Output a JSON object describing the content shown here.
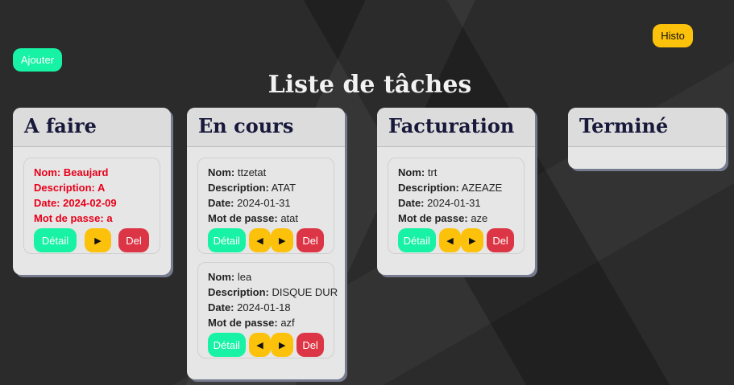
{
  "toolbar": {
    "add_label": "Ajouter",
    "history_label": "Histo"
  },
  "page_title": "Liste de tâches",
  "field_labels": {
    "name": "Nom:",
    "description": "Description:",
    "date": "Date:",
    "password": "Mot de passe:"
  },
  "button_labels": {
    "detail": "Détail",
    "prev": "◀",
    "next": "▶",
    "delete": "Del"
  },
  "columns": [
    {
      "title": "A faire",
      "tasks": [
        {
          "name": "Beaujard",
          "description": "A",
          "date": "2024-02-09",
          "password": "a"
        }
      ]
    },
    {
      "title": "En cours",
      "tasks": [
        {
          "name": "ttzetat",
          "description": "ATAT",
          "date": "2024-01-31",
          "password": "atat"
        },
        {
          "name": "lea",
          "description": "DISQUE DUR",
          "date": "2024-01-18",
          "password": "azf"
        }
      ]
    },
    {
      "title": "Facturation",
      "tasks": [
        {
          "name": "trt",
          "description": "AZEAZE",
          "date": "2024-01-31",
          "password": "aze"
        }
      ]
    },
    {
      "title": "Terminé",
      "tasks": []
    }
  ],
  "colors": {
    "primary": "#17f2a4",
    "warning": "#fcc10a",
    "danger": "#dc3545",
    "urgent_text": "#e8001a"
  }
}
